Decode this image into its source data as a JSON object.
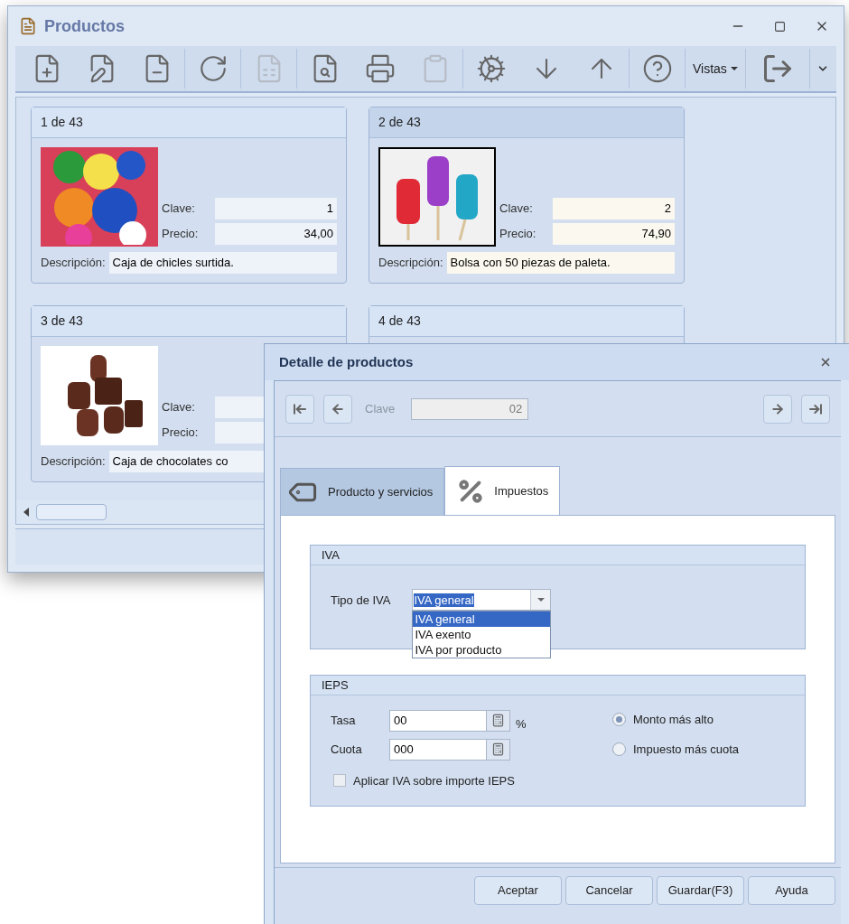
{
  "main_window": {
    "title": "Productos",
    "toolbar": [
      {
        "disabled": false
      },
      {
        "disabled": false
      },
      {
        "disabled": false
      },
      {
        "disabled": false
      },
      {
        "disabled": true
      },
      {
        "disabled": false
      },
      {
        "disabled": false
      },
      {
        "disabled": true
      },
      {
        "disabled": false
      },
      {
        "disabled": false
      },
      {
        "disabled": false
      },
      {
        "disabled": false
      }
    ],
    "views_menu": "Vistas",
    "cards": [
      {
        "header": "1 de 43",
        "selected": false,
        "clave_label": "Clave:",
        "clave": "1",
        "precio_label": "Precio:",
        "precio": "34,00",
        "descripcion_label": "Descripción:",
        "descripcion": "Caja de chicles surtida.",
        "kind": "gumballs"
      },
      {
        "header": "2 de 43",
        "selected": true,
        "clave_label": "Clave:",
        "clave": "2",
        "precio_label": "Precio:",
        "precio": "74,90",
        "descripcion_label": "Descripción:",
        "descripcion": "Bolsa con 50 piezas de paleta.",
        "kind": "lollipops"
      },
      {
        "header": "3 de 43",
        "selected": false,
        "clave_label": "Clave:",
        "precio_label": "Precio:",
        "descripcion_label": "Descripción:",
        "descripcion": "Caja de chocolates co",
        "kind": "chocolates"
      },
      {
        "header": "4 de 43",
        "selected": false,
        "kind": "hidden"
      }
    ]
  },
  "dialog": {
    "title": "Detalle de productos",
    "clave_label": "Clave",
    "clave_value": "02",
    "tabs": [
      {
        "label": "Producto y servicios",
        "selected": false,
        "kind": "tag"
      },
      {
        "label": "Impuestos",
        "selected": true,
        "kind": "percent"
      }
    ],
    "iva": {
      "title": "IVA",
      "label": "Tipo de IVA",
      "value": "IVA general",
      "expanded": true,
      "options": [
        {
          "label": "IVA general",
          "selected": true
        },
        {
          "label": "IVA exento",
          "selected": false
        },
        {
          "label": "IVA por producto",
          "selected": false
        }
      ]
    },
    "ieps": {
      "title": "IEPS",
      "tasa_label": "Tasa",
      "tasa": "00",
      "percent": "%",
      "cuota_label": "Cuota",
      "cuota": "000",
      "radios": [
        {
          "label": "Monto más alto",
          "selected": true
        },
        {
          "label": "Impuesto más cuota",
          "selected": false
        }
      ],
      "checkbox": {
        "label": "Aplicar IVA sobre importe IEPS",
        "checked": false
      }
    },
    "buttons": [
      "Aceptar",
      "Cancelar",
      "Guardar(F3)",
      "Ayuda"
    ]
  }
}
